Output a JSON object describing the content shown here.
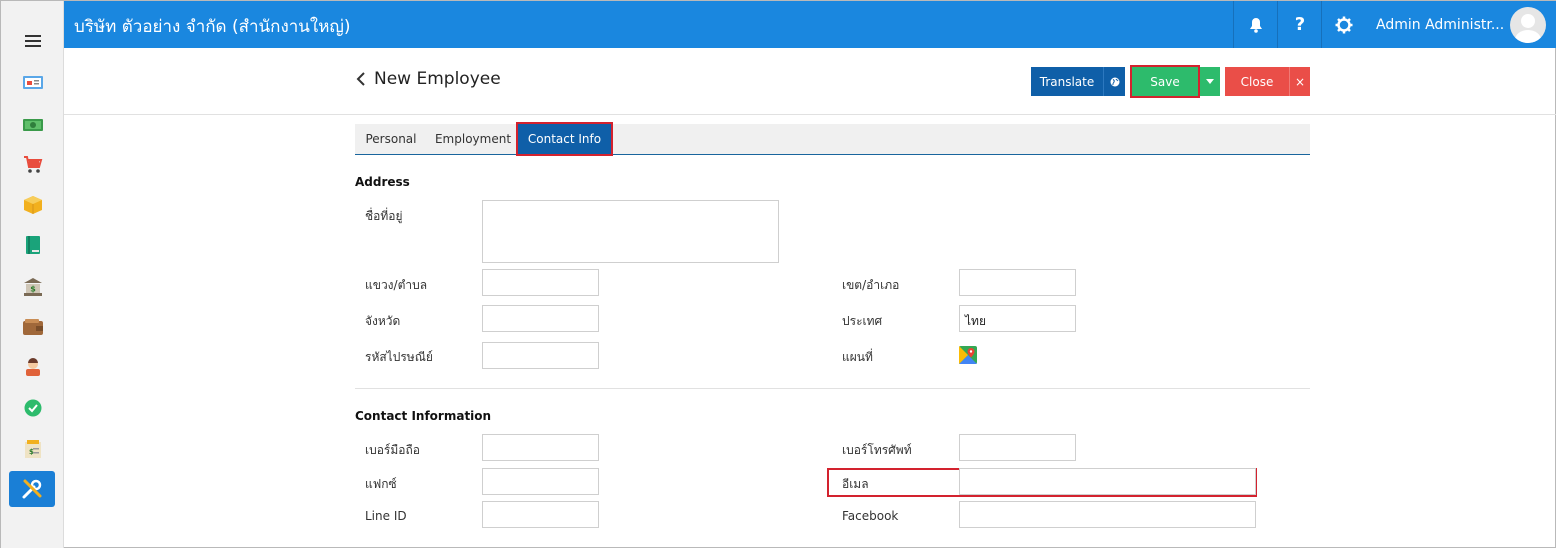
{
  "header": {
    "company": "บริษัท ตัวอย่าง จำกัด (สำนักงานใหญ่)",
    "user_name": "Admin Administr...",
    "help_label": "?"
  },
  "sidebar": {
    "items": [
      {
        "name": "dashboard-icon",
        "color": "#e84c3d"
      },
      {
        "name": "money-icon",
        "color": "#3a9a4a"
      },
      {
        "name": "cart-icon",
        "color": "#e84c3d"
      },
      {
        "name": "box-icon",
        "color": "#f2b01e"
      },
      {
        "name": "book-icon",
        "color": "#1aa37a"
      },
      {
        "name": "bank-icon",
        "color": "#7a6a55"
      },
      {
        "name": "wallet-icon",
        "color": "#a0683a"
      },
      {
        "name": "person-icon",
        "color": "#e0623a"
      },
      {
        "name": "check-icon",
        "color": "#2dbb6c"
      },
      {
        "name": "report-icon",
        "color": "#f2b01e"
      },
      {
        "name": "tools-icon",
        "color": "#ffffff"
      }
    ]
  },
  "page": {
    "title": "New Employee",
    "buttons": {
      "translate": "Translate",
      "save": "Save",
      "close": "Close",
      "close_x": "×"
    }
  },
  "tabs": [
    {
      "label": "Personal"
    },
    {
      "label": "Employment"
    },
    {
      "label": "Contact Info"
    }
  ],
  "address": {
    "section_title": "Address",
    "address_name_label": "ชื่อที่อยู่",
    "subdistrict_label": "แขวง/ตำบล",
    "district_label": "เขต/อำเภอ",
    "province_label": "จังหวัด",
    "country_label": "ประเทศ",
    "country_value": "ไทย",
    "postal_label": "รหัสไปรษณีย์",
    "map_label": "แผนที่"
  },
  "contact": {
    "section_title": "Contact Information",
    "mobile_label": "เบอร์มือถือ",
    "phone_label": "เบอร์โทรศัพท์",
    "fax_label": "แฟกซ์",
    "email_label": "อีเมล",
    "line_label": "Line ID",
    "facebook_label": "Facebook"
  },
  "colors": {
    "topbar": "#1a87df",
    "primary": "#0f5fa8",
    "save": "#2dbb6c",
    "close": "#ea4e48",
    "highlight": "#d3222e"
  }
}
